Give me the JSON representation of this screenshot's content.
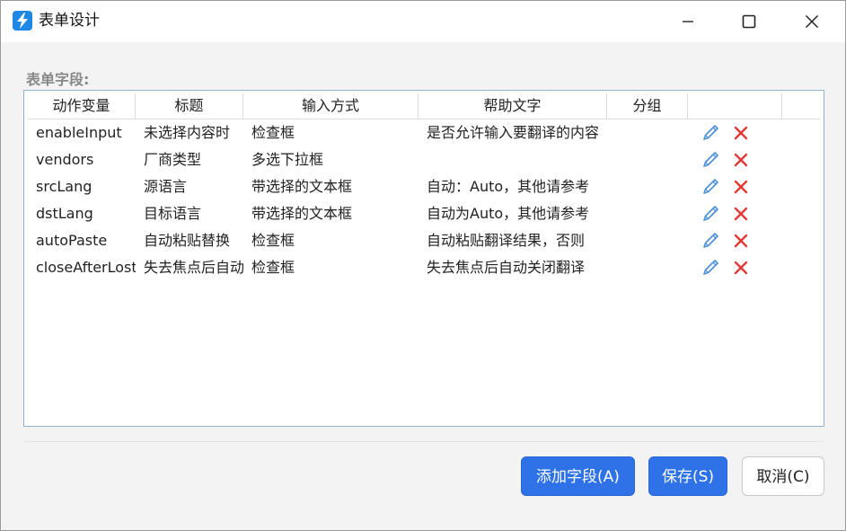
{
  "window": {
    "title": "表单设计"
  },
  "section_label": "表单字段:",
  "table": {
    "columns": [
      "动作变量",
      "标题",
      "输入方式",
      "帮助文字",
      "分组",
      ""
    ],
    "rows": [
      {
        "var": "enableInput",
        "title": "未选择内容时",
        "input": "检查框",
        "help": "是否允许输入要翻译的内容",
        "group": ""
      },
      {
        "var": "vendors",
        "title": "厂商类型",
        "input": "多选下拉框",
        "help": "",
        "group": ""
      },
      {
        "var": "srcLang",
        "title": "源语言",
        "input": "带选择的文本框",
        "help": "自动：Auto，其他请参考",
        "group": ""
      },
      {
        "var": "dstLang",
        "title": "目标语言",
        "input": "带选择的文本框",
        "help": "自动为Auto，其他请参考",
        "group": ""
      },
      {
        "var": "autoPaste",
        "title": "自动粘贴替换",
        "input": "检查框",
        "help": "自动粘贴翻译结果，否则",
        "group": ""
      },
      {
        "var": "closeAfterLostFocus",
        "title": "失去焦点后自动关闭",
        "input": "检查框",
        "help": "失去焦点后自动关闭翻译",
        "group": ""
      }
    ],
    "row_icons": [
      "pencil-icon",
      "delete-x-icon"
    ]
  },
  "buttons": {
    "add": "添加字段(A)",
    "save": "保存(S)",
    "cancel": "取消(C)"
  },
  "colors": {
    "primary": "#2f72e8",
    "delete": "#e53935",
    "edit": "#4a90d9",
    "grid_border": "#8fb4cf"
  }
}
